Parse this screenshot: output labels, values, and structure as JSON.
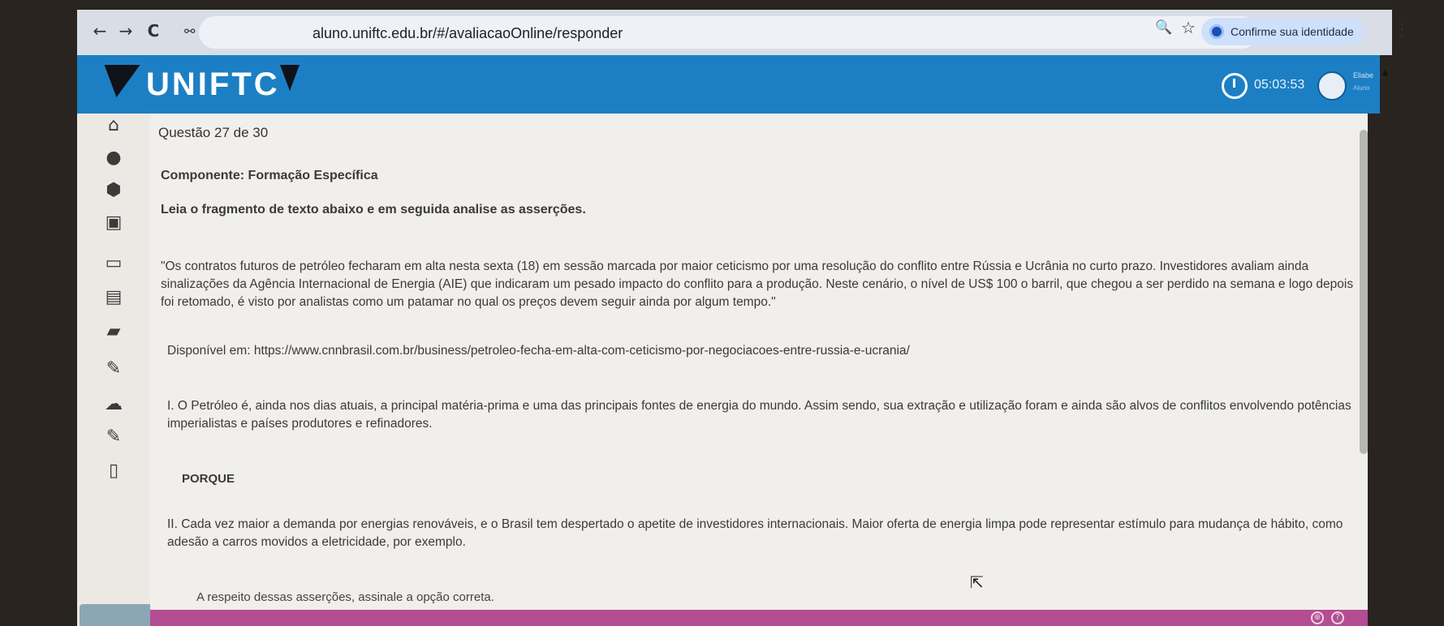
{
  "browser": {
    "back": "←",
    "forward": "→",
    "reload": "C",
    "site_info": "⚯",
    "url": "aluno.uniftc.edu.br/#/avaliacaoOnline/responder",
    "zoom_icon": "🔍",
    "bookmark_icon": "☆",
    "identity_label": "Confirme sua identidade",
    "menu": "⋮"
  },
  "header": {
    "logo": "UNIFTC",
    "timer": "05:03:53",
    "user_name": "Eliabe",
    "user_role": "Aluno",
    "brand_color": "#1c7fc4"
  },
  "sidebar": {
    "icons": [
      "home-icon",
      "alert-icon",
      "cube-icon",
      "bank-icon",
      "monitor-icon",
      "calendar-icon",
      "folder-icon",
      "pencil-icon",
      "chat-icon",
      "pencil-icon",
      "document-icon"
    ]
  },
  "question": {
    "number_label": "Questão 27 de 30",
    "component": "Componente: Formação Específica",
    "instruction": "Leia o fragmento de texto abaixo e em seguida analise as asserções.",
    "quote": "\"Os contratos futuros de petróleo fecharam em alta nesta sexta (18) em sessão marcada por maior ceticismo por uma resolução do conflito entre Rússia e Ucrânia no curto prazo. Investidores avaliam ainda sinalizações da Agência Internacional de Energia (AIE) que indicaram um pesado impacto do conflito para a produção. Neste cenário, o nível de US$ 100 o barril, que chegou a ser perdido na semana e logo depois foi retomado, é visto por analistas como um patamar no qual os preços devem seguir ainda por algum tempo.\"",
    "source": "Disponível em: https://www.cnnbrasil.com.br/business/petroleo-fecha-em-alta-com-ceticismo-por-negociacoes-entre-russia-e-ucrania/",
    "assertion_1": "I. O Petróleo é, ainda nos dias atuais, a principal matéria-prima e uma das principais fontes de energia do mundo. Assim sendo, sua extração e utilização foram e ainda são alvos de conflitos envolvendo potências imperialistas e países produtores e refinadores.",
    "connector": "PORQUE",
    "assertion_2": "II. Cada vez maior a demanda por energias renováveis, e o Brasil tem despertado o apetite de investidores internacionais. Maior oferta de energia limpa pode representar estímulo para mudança de hábito, como adesão a carros movidos a eletricidade, por exemplo.",
    "prompt": "A respeito dessas asserções, assinale a opção correta."
  },
  "footer": {
    "color": "#b54d93",
    "icons": [
      "globe-icon",
      "help-icon"
    ]
  }
}
